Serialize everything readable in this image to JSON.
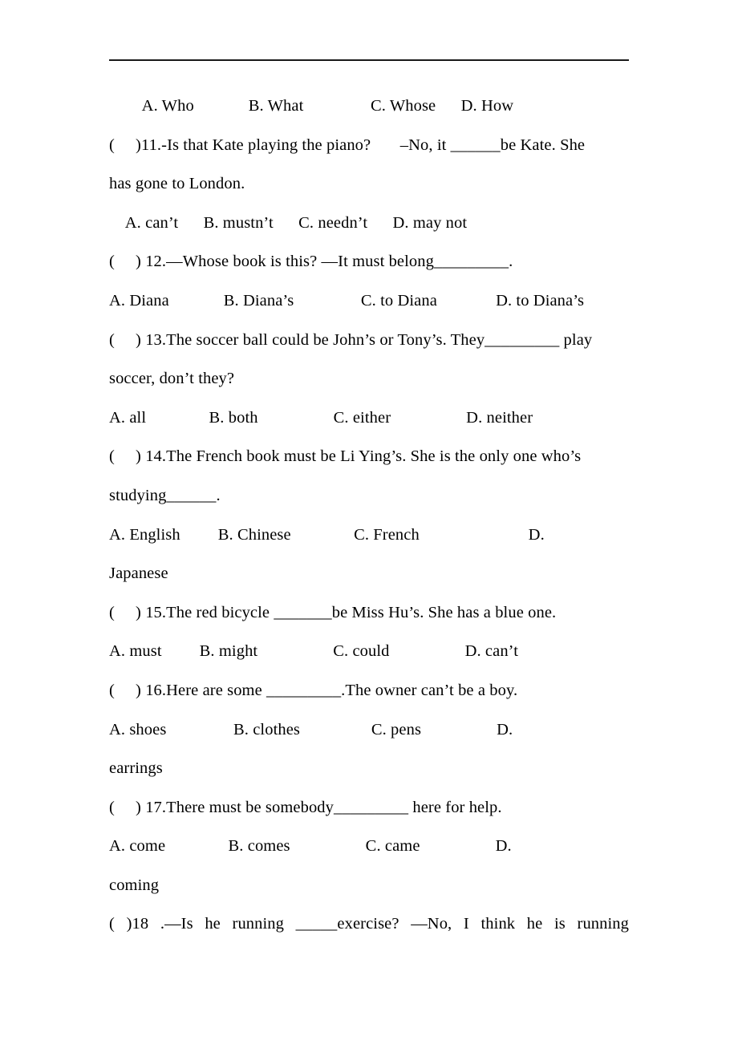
{
  "document": {
    "type": "multiple-choice-worksheet",
    "language": "English",
    "rule_present": true
  },
  "lines": {
    "l01": "        A. Who             B. What                C. Whose      D. How",
    "l02": "(     )11.-Is that Kate playing the piano?       –No, it ______be Kate. She",
    "l03": "has gone to London.",
    "l04": "    A. can’t      B. mustn’t      C. needn’t      D. may not",
    "l05": "(     ) 12.—Whose book is this? —It must belong_________.",
    "l06": "A. Diana             B. Diana’s                C. to Diana              D. to Diana’s",
    "l07": "(     ) 13.The soccer ball could be John’s or Tony’s. They_________ play",
    "l08": "soccer, don’t they?",
    "l09": "A. all               B. both                  C. either                  D. neither",
    "l10": "(     ) 14.The French book must be Li Ying’s. She is the only one who’s",
    "l11": "studying______.",
    "l12": "A. English         B. Chinese               C. French                          D.",
    "l13": "Japanese",
    "l14": "(     ) 15.The red bicycle _______be Miss Hu’s. She has a blue one.",
    "l15": "A. must         B. might                  C. could                  D. can’t",
    "l16": "(     ) 16.Here are some _________.The owner can’t be a boy.",
    "l17": "A. shoes                B. clothes                 C. pens                  D.",
    "l18": "earrings",
    "l19": "(     ) 17.There must be somebody_________ here for help.",
    "l20": "A. come               B. comes                  C. came                  D.",
    "l21": "coming",
    "l22": "(     )18 .—Is he running _____exercise? —No, I think he is running"
  },
  "questions": [
    {
      "number": "11",
      "stem": "-Is that Kate playing the piano?       –No, it ______be Kate. She has gone to London.",
      "options": [
        "A. can’t",
        "B. mustn’t",
        "C. needn’t",
        "D. may not"
      ]
    },
    {
      "number": "12",
      "stem": "—Whose book is this? —It must belong_________.",
      "options": [
        "A. Diana",
        "B. Diana’s",
        "C. to Diana",
        "D. to Diana’s"
      ]
    },
    {
      "number": "13",
      "stem": "The soccer ball could be John’s or Tony’s. They_________ play soccer, don’t they?",
      "options": [
        "A. all",
        "B. both",
        "C. either",
        "D. neither"
      ]
    },
    {
      "number": "14",
      "stem": "The French book must be Li Ying’s. She is the only one who’s studying______.",
      "options": [
        "A. English",
        "B. Chinese",
        "C. French",
        "D. Japanese"
      ]
    },
    {
      "number": "15",
      "stem": "The red bicycle _______be Miss Hu’s. She has a blue one.",
      "options": [
        "A. must",
        "B. might",
        "C. could",
        "D. can’t"
      ]
    },
    {
      "number": "16",
      "stem": "Here are some _________.The owner can’t be a boy.",
      "options": [
        "A. shoes",
        "B. clothes",
        "C. pens",
        "D. earrings"
      ]
    },
    {
      "number": "17",
      "stem": "There must be somebody_________ here for help.",
      "options": [
        "A. come",
        "B. comes",
        "C. came",
        "D. coming"
      ]
    },
    {
      "number": "18",
      "stem": "—Is he running _____exercise? —No, I think he is running",
      "options": []
    }
  ],
  "orphan_options_top": [
    "A. Who",
    "B. What",
    "C. Whose",
    "D. How"
  ]
}
